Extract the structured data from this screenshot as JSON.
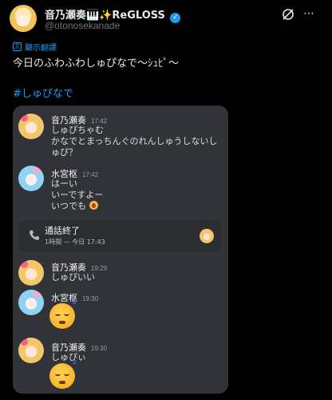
{
  "author": {
    "display_name": "音乃瀬奏🎹✨ReGLOSS",
    "verified_mark": "✓",
    "handle": "@otonosekanade",
    "grok_icon": "grok-icon",
    "more_icon": "more-icon",
    "more_glyph": "⋯"
  },
  "translate_label": "顯示翻譯",
  "post_text": "今日のふわふわしゅぴなで〜ｼｭﾋﾟ～",
  "hashtag": "#しゅぴなで",
  "chat": {
    "messages": [
      {
        "name": "音乃瀬奏",
        "time": "17:42",
        "lines": [
          "しゅぴちゃむ",
          "かなでとまっちんぐのれんしゅうしないし",
          "ゅぴ？"
        ]
      },
      {
        "name": "水宮枢",
        "time": "17:42",
        "lines": [
          "はーい",
          "いーですよー",
          "いつでも"
        ]
      },
      {
        "name": "音乃瀬奏",
        "time": "19:29",
        "lines": [
          "しゅぴいい"
        ]
      },
      {
        "name": "水宮枢",
        "time": "19:30",
        "lines": []
      },
      {
        "name": "音乃瀬奏",
        "time": "19:30",
        "lines": [
          "しゅぴぃ"
        ]
      }
    ],
    "call": {
      "title": "通話終了",
      "detail": "1時間 — 今日 17:43",
      "icon": "phone-icon"
    },
    "sleep_emoji_z": "z"
  },
  "colors": {
    "background": "#000000",
    "accent_blue": "#1d9bf0",
    "chat_bg": "#313338"
  }
}
